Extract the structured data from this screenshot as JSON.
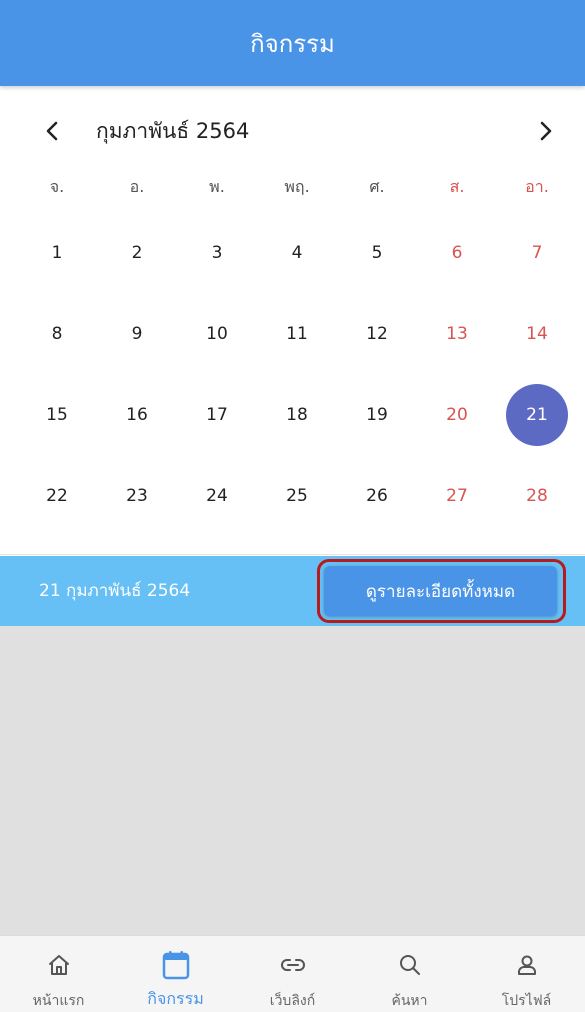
{
  "app_bar": {
    "title": "กิจกรรม"
  },
  "calendar": {
    "month_label": "กุมภาพันธ์ 2564",
    "weekdays": [
      "จ.",
      "อ.",
      "พ.",
      "พฤ.",
      "ศ.",
      "ส.",
      "อา."
    ],
    "weeks": [
      [
        "1",
        "2",
        "3",
        "4",
        "5",
        "6",
        "7"
      ],
      [
        "8",
        "9",
        "10",
        "11",
        "12",
        "13",
        "14"
      ],
      [
        "15",
        "16",
        "17",
        "18",
        "19",
        "20",
        "21"
      ],
      [
        "22",
        "23",
        "24",
        "25",
        "26",
        "27",
        "28"
      ]
    ],
    "selected_day": "21",
    "weekend_color": "#d9534f",
    "selected_color": "#5c6ac4",
    "prev_icon": "chevron-left-icon",
    "next_icon": "chevron-right-icon"
  },
  "selected_bar": {
    "date_text": "21 กุมภาพันธ์ 2564",
    "view_all_label": "ดูรายละเอียดทั้งหมด"
  },
  "bottom_nav": {
    "items": [
      {
        "label": "หน้าแรก",
        "icon": "home-icon",
        "active": false
      },
      {
        "label": "กิจกรรม",
        "icon": "calendar-icon",
        "active": true
      },
      {
        "label": "เว็บลิงก์",
        "icon": "link-icon",
        "active": false
      },
      {
        "label": "ค้นหา",
        "icon": "search-icon",
        "active": false
      },
      {
        "label": "โปรไฟล์",
        "icon": "profile-icon",
        "active": false
      }
    ]
  },
  "colors": {
    "app_bar": "#4a94e8",
    "info_bar": "#66bff5",
    "button": "#4a94e8",
    "highlight_outline": "#b71c1c",
    "event_area": "#e0e0e0"
  }
}
